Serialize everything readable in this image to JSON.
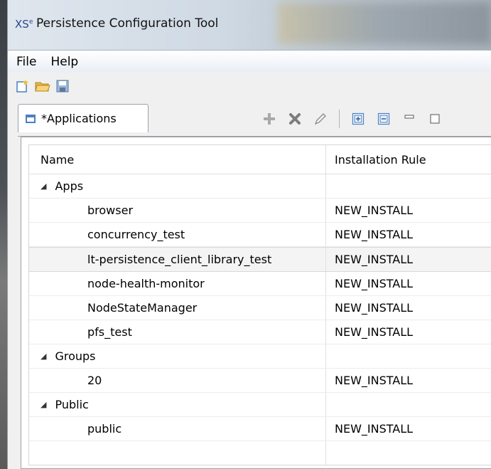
{
  "window": {
    "logo": "XS",
    "logo_sup": "e",
    "title": "Persistence Configuration Tool"
  },
  "menu": {
    "file": "File",
    "help": "Help"
  },
  "toolbar_icons": [
    "new-file-icon",
    "open-folder-icon",
    "save-icon"
  ],
  "tab": {
    "label": "*Applications"
  },
  "tab_tools": [
    "add-icon",
    "delete-icon",
    "edit-icon",
    "expand-all-icon",
    "collapse-all-icon",
    "minimize-icon",
    "maximize-icon"
  ],
  "table": {
    "columns": {
      "name": "Name",
      "rule": "Installation Rule"
    },
    "groups": [
      {
        "label": "Apps",
        "items": [
          {
            "name": "browser",
            "rule": "NEW_INSTALL"
          },
          {
            "name": "concurrency_test",
            "rule": "NEW_INSTALL"
          },
          {
            "name": "lt-persistence_client_library_test",
            "rule": "NEW_INSTALL"
          },
          {
            "name": "node-health-monitor",
            "rule": "NEW_INSTALL"
          },
          {
            "name": "NodeStateManager",
            "rule": "NEW_INSTALL"
          },
          {
            "name": "pfs_test",
            "rule": "NEW_INSTALL"
          }
        ]
      },
      {
        "label": "Groups",
        "items": [
          {
            "name": "20",
            "rule": "NEW_INSTALL"
          }
        ]
      },
      {
        "label": "Public",
        "items": [
          {
            "name": "public",
            "rule": "NEW_INSTALL"
          }
        ]
      }
    ]
  },
  "colors": {
    "accent": "#4a7fc1",
    "tool_green": "#5aa02c",
    "tool_grey": "#7d7d7d"
  }
}
